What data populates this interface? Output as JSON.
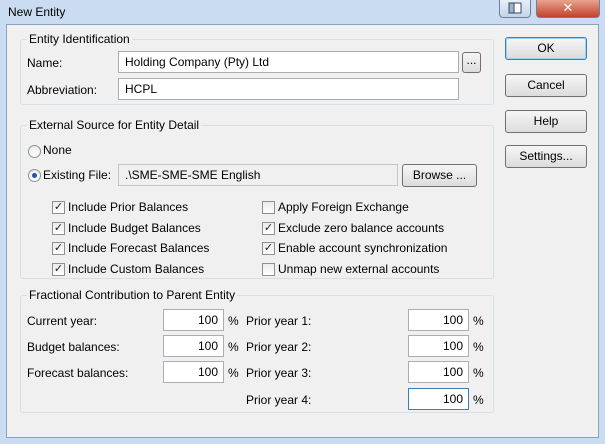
{
  "window": {
    "title": "New Entity"
  },
  "entity_identification": {
    "title": "Entity Identification",
    "name_label": "Name:",
    "name_value": "Holding Company (Pty) Ltd",
    "ellipsis_label": "...",
    "abbreviation_label": "Abbreviation:",
    "abbreviation_value": "HCPL"
  },
  "external_source": {
    "title": "External Source for Entity Detail",
    "none_label": "None",
    "existing_file_label": "Existing File:",
    "file_value": ".\\SME-SME-SME English",
    "browse_label": "Browse ...",
    "selected": "existing_file",
    "checkboxes_left": [
      {
        "label": "Include Prior Balances",
        "checked": true
      },
      {
        "label": "Include Budget Balances",
        "checked": true
      },
      {
        "label": "Include Forecast Balances",
        "checked": true
      },
      {
        "label": "Include Custom Balances",
        "checked": true
      }
    ],
    "checkboxes_right": [
      {
        "label": "Apply Foreign Exchange",
        "checked": false
      },
      {
        "label": "Exclude zero balance accounts",
        "checked": true
      },
      {
        "label": "Enable account synchronization",
        "checked": true
      },
      {
        "label": "Unmap new external accounts",
        "checked": false
      }
    ]
  },
  "fractional": {
    "title": "Fractional Contribution to Parent Entity",
    "percent_sign": "%",
    "left": [
      {
        "label": "Current year:",
        "value": "100"
      },
      {
        "label": "Budget balances:",
        "value": "100"
      },
      {
        "label": "Forecast balances:",
        "value": "100"
      }
    ],
    "right": [
      {
        "label": "Prior year 1:",
        "value": "100"
      },
      {
        "label": "Prior year 2:",
        "value": "100"
      },
      {
        "label": "Prior year 3:",
        "value": "100"
      },
      {
        "label": "Prior year 4:",
        "value": "100"
      }
    ]
  },
  "buttons": {
    "ok": "OK",
    "cancel": "Cancel",
    "help": "Help",
    "settings": "Settings..."
  },
  "titlebar_buttons": {
    "close_glyph": "✕"
  },
  "icons": {
    "help": "help-window-icon",
    "close": "close-icon"
  }
}
